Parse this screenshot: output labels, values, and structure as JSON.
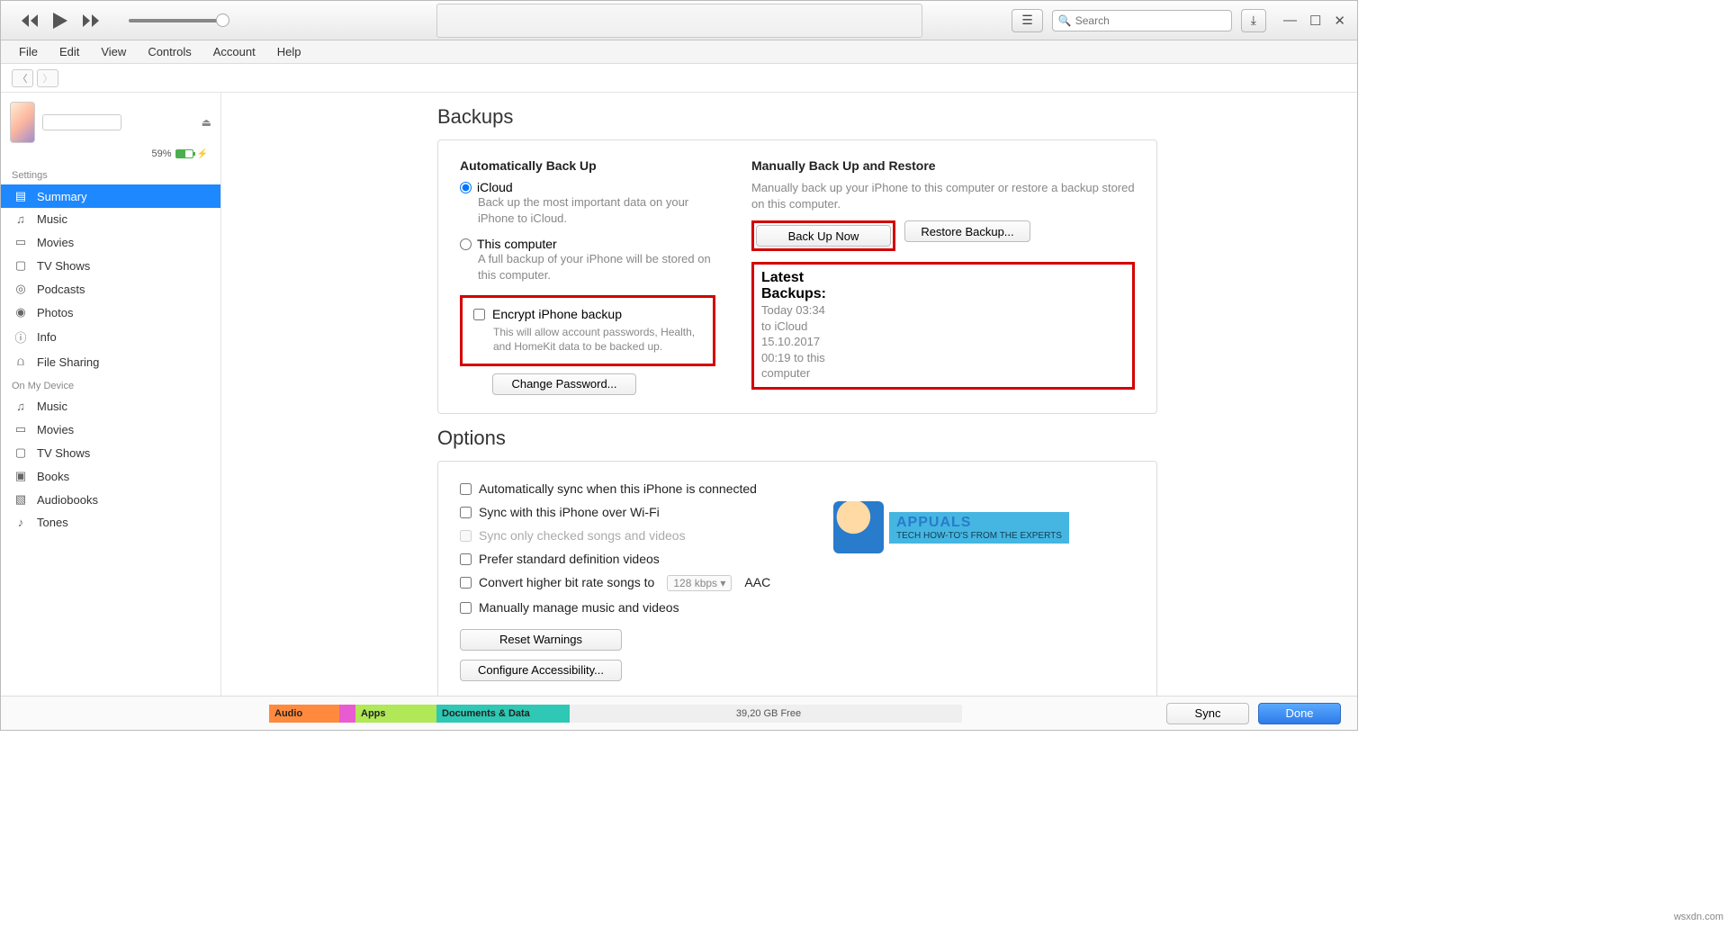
{
  "menubar": [
    "File",
    "Edit",
    "View",
    "Controls",
    "Account",
    "Help"
  ],
  "search": {
    "placeholder": "Search"
  },
  "device": {
    "battery": "59%"
  },
  "sidebar": {
    "settings_hdr": "Settings",
    "settings": [
      {
        "label": "Summary",
        "icon": "▤",
        "sel": true
      },
      {
        "label": "Music",
        "icon": "♫"
      },
      {
        "label": "Movies",
        "icon": "▭"
      },
      {
        "label": "TV Shows",
        "icon": "▢"
      },
      {
        "label": "Podcasts",
        "icon": "◎"
      },
      {
        "label": "Photos",
        "icon": "◉"
      },
      {
        "label": "Info",
        "icon": "ⓘ"
      },
      {
        "label": "File Sharing",
        "icon": "⩍"
      }
    ],
    "device_hdr": "On My Device",
    "device": [
      {
        "label": "Music",
        "icon": "♫"
      },
      {
        "label": "Movies",
        "icon": "▭"
      },
      {
        "label": "TV Shows",
        "icon": "▢"
      },
      {
        "label": "Books",
        "icon": "▣"
      },
      {
        "label": "Audiobooks",
        "icon": "▧"
      },
      {
        "label": "Tones",
        "icon": "♪"
      }
    ]
  },
  "backups": {
    "title": "Backups",
    "auto_hdr": "Automatically Back Up",
    "icloud": "iCloud",
    "icloud_sub": "Back up the most important data on your iPhone to iCloud.",
    "thispc": "This computer",
    "thispc_sub": "A full backup of your iPhone will be stored on this computer.",
    "encrypt": "Encrypt iPhone backup",
    "encrypt_sub": "This will allow account passwords, Health, and HomeKit data to be backed up.",
    "change_pw": "Change Password...",
    "manual_hdr": "Manually Back Up and Restore",
    "manual_sub": "Manually back up your iPhone to this computer or restore a backup stored on this computer.",
    "backup_now": "Back Up Now",
    "restore": "Restore Backup...",
    "latest_hdr": "Latest Backups:",
    "latest_1": "Today 03:34 to iCloud",
    "latest_2": "15.10.2017 00:19 to this computer"
  },
  "options": {
    "title": "Options",
    "auto_sync": "Automatically sync when this iPhone is connected",
    "wifi": "Sync with this iPhone over Wi-Fi",
    "checked_only": "Sync only checked songs and videos",
    "sd": "Prefer standard definition videos",
    "bitrate_pre": "Convert higher bit rate songs to",
    "bitrate_val": "128 kbps",
    "bitrate_suf": "AAC",
    "manual": "Manually manage music and videos",
    "reset": "Reset Warnings",
    "access": "Configure Accessibility..."
  },
  "bottom": {
    "audio": "Audio",
    "apps": "Apps",
    "docs": "Documents & Data",
    "free": "39,20 GB Free",
    "sync": "Sync",
    "done": "Done"
  },
  "watermark": {
    "brand": "APPUALS",
    "tag": "TECH HOW-TO'S FROM THE EXPERTS"
  },
  "attribution": "wsxdn.com"
}
